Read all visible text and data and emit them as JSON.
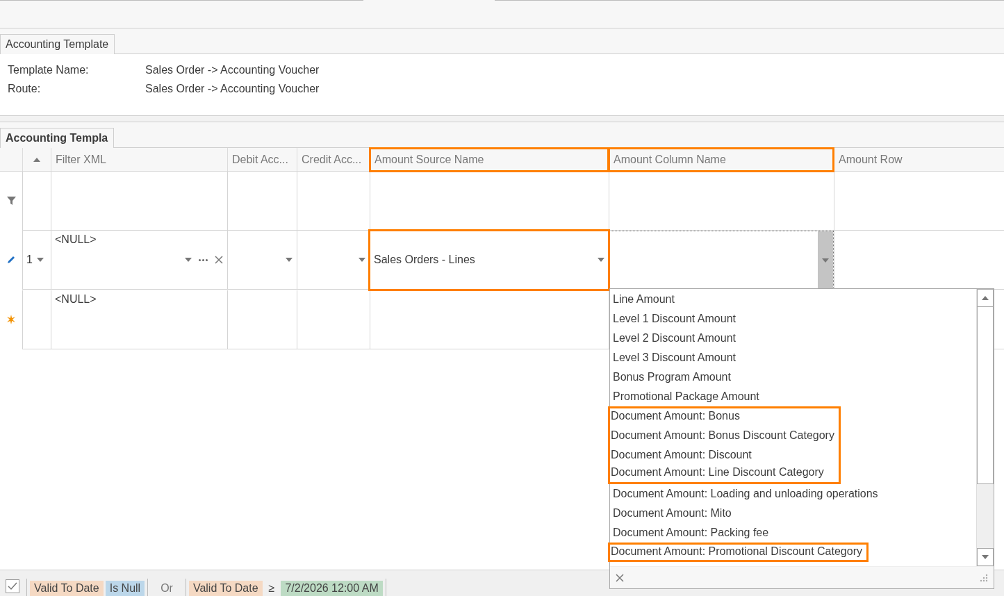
{
  "header_tab": {
    "label": "Accounting Template"
  },
  "info": [
    {
      "label": "Template Name:",
      "value": "Sales Order -> Accounting Voucher"
    },
    {
      "label": "Route:",
      "value": "Sales Order -> Accounting Voucher"
    }
  ],
  "grid_tab": {
    "label": "Accounting Templa"
  },
  "columns": [
    {
      "label": "Filter XML",
      "highlighted": false
    },
    {
      "label": "Debit Acc...",
      "highlighted": false
    },
    {
      "label": "Credit Acc...",
      "highlighted": false
    },
    {
      "label": "Amount Source Name",
      "highlighted": true
    },
    {
      "label": "Amount Column Name",
      "highlighted": true
    },
    {
      "label": "Amount Row",
      "highlighted": false
    }
  ],
  "rows": [
    {
      "kind": "edit",
      "number": "1",
      "cells": [
        {
          "kind": "lookup",
          "value": "<NULL>",
          "highlighted": false
        },
        {
          "kind": "combo",
          "highlighted": false
        },
        {
          "kind": "combo",
          "highlighted": false
        },
        {
          "kind": "combo",
          "value": "Sales Orders - Lines",
          "highlighted": true
        },
        {
          "kind": "active",
          "highlighted": false
        },
        {
          "kind": "plain",
          "highlighted": false
        }
      ]
    },
    {
      "kind": "new",
      "cells": [
        {
          "kind": "plain",
          "value": "<NULL>",
          "highlighted": false
        },
        {
          "kind": "plain",
          "highlighted": false
        },
        {
          "kind": "plain",
          "highlighted": false
        },
        {
          "kind": "plain",
          "highlighted": false
        },
        {
          "kind": "plain",
          "highlighted": false
        },
        {
          "kind": "plain",
          "highlighted": false
        }
      ]
    }
  ],
  "dropdown": {
    "items": [
      {
        "label": "Line Amount",
        "highlighted": false
      },
      {
        "label": "Level 1 Discount Amount",
        "highlighted": false
      },
      {
        "label": "Level 2 Discount Amount",
        "highlighted": false
      },
      {
        "label": "Level 3 Discount Amount",
        "highlighted": false
      },
      {
        "label": "Bonus Program Amount",
        "highlighted": false
      },
      {
        "label": "Promotional Package Amount",
        "highlighted": false
      },
      {
        "label": "Document Amount: Bonus",
        "highlighted": true
      },
      {
        "label": "Document Amount: Bonus Discount Category",
        "highlighted": true
      },
      {
        "label": "Document Amount: Discount",
        "highlighted": true
      },
      {
        "label": "Document Amount: Line Discount Category",
        "highlighted": true
      },
      {
        "label": "Document Amount: Loading and unloading operations",
        "highlighted": false
      },
      {
        "label": "Document Amount: Mito",
        "highlighted": false
      },
      {
        "label": "Document Amount: Packing fee",
        "highlighted": false
      },
      {
        "label": "Document Amount: Promotional Discount Category",
        "highlighted": true
      }
    ]
  },
  "filter": {
    "enabled": true,
    "parts": [
      {
        "kind": "group",
        "tokens": [
          {
            "kind": "field",
            "text": "Valid To Date"
          },
          {
            "kind": "operator",
            "text": "Is Null"
          }
        ]
      },
      {
        "kind": "join",
        "text": "Or"
      },
      {
        "kind": "group",
        "tokens": [
          {
            "kind": "field",
            "text": "Valid To Date"
          },
          {
            "kind": "symbol",
            "text": "≥"
          },
          {
            "kind": "value",
            "text": "7/2/2026 12:00 AM"
          }
        ]
      }
    ]
  }
}
